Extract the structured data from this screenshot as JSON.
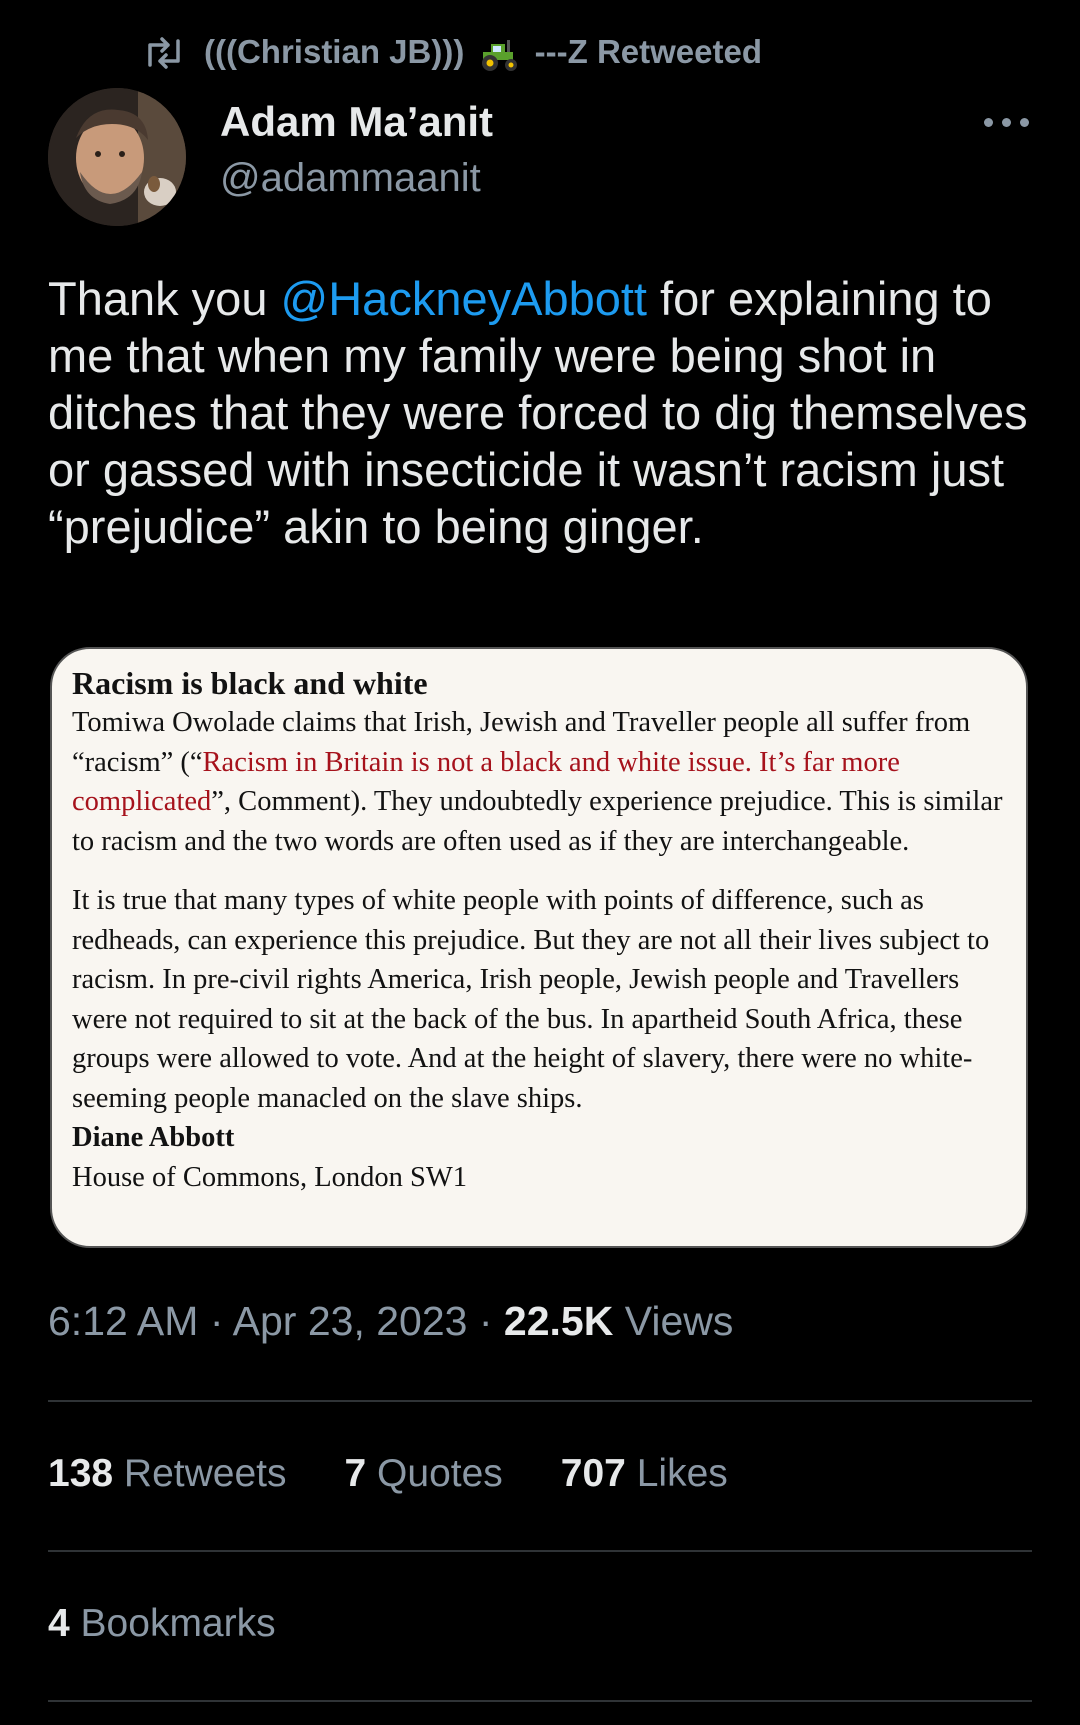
{
  "retweet": {
    "icon": "retweet-icon",
    "name_prefix": "(((Christian JB)))",
    "emoji": "tractor-emoji",
    "name_suffix": "---Z Retweeted"
  },
  "author": {
    "display_name": "Adam Ma’anit",
    "handle": "@adammaanit"
  },
  "tweet": {
    "text_before": "Thank you ",
    "mention": "@HackneyAbbott",
    "text_after": " for explaining to me that when my family were being shot in ditches that they were forced to dig themselves or gassed with insecticide it wasn’t racism just “prejudice” akin to being ginger."
  },
  "clipping": {
    "headline": "Racism is black and white",
    "p1_before": "Tomiwa Owolade claims that Irish, Jewish and Traveller people all suffer from “racism” (“",
    "p1_link": "Racism in Britain is not a black and white issue. It’s far more complicated",
    "p1_after": "”, Comment). They undoubtedly experience prejudice. This is similar to racism and the two words are often used as if they are interchangeable.",
    "p2": "It is true that many types of white people with points of difference, such as redheads, can experience this prejudice. But they are not all their lives subject to racism. In pre-civil rights America, Irish people, Jewish people and Travellers were not required to sit at the back of the bus. In apartheid South Africa, these groups were allowed to vote. And at the height of slavery, there were no white-seeming people manacled on the slave ships.",
    "signature": "Diane Abbott",
    "address": "House of Commons, London SW1"
  },
  "meta": {
    "time": "6:12 AM",
    "sep": "·",
    "date": "Apr 23, 2023",
    "views_count": "22.5K",
    "views_label": "Views"
  },
  "stats": {
    "retweets_count": "138",
    "retweets_label": "Retweets",
    "quotes_count": "7",
    "quotes_label": "Quotes",
    "likes_count": "707",
    "likes_label": "Likes"
  },
  "bookmarks": {
    "count": "4",
    "label": "Bookmarks"
  },
  "colors": {
    "background": "#000000",
    "text": "#e7e9ea",
    "secondary": "#8b98a5",
    "mention": "#1d9bf0",
    "clipping_link": "#a6121c",
    "divider": "#2f3336"
  }
}
